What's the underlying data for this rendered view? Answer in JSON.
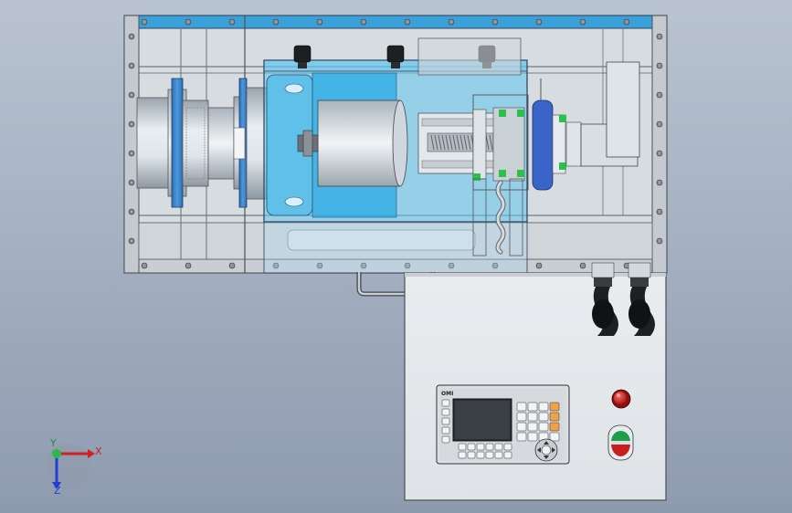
{
  "triad": {
    "x_label": "X",
    "y_label": "Y",
    "z_label": "Z"
  },
  "hmi": {
    "brand": "OMI",
    "screen_color": "#2b2f33"
  },
  "colors": {
    "background_top": "#b9c3d1",
    "background_bottom": "#8e9aae",
    "frame_rail": "#3ca0d8",
    "transparent_cover": "#5fc4ee",
    "motor_body": "#cfd6dd",
    "stop_button": "#c81e1e",
    "start_button_ring": "#1f9e4a"
  }
}
